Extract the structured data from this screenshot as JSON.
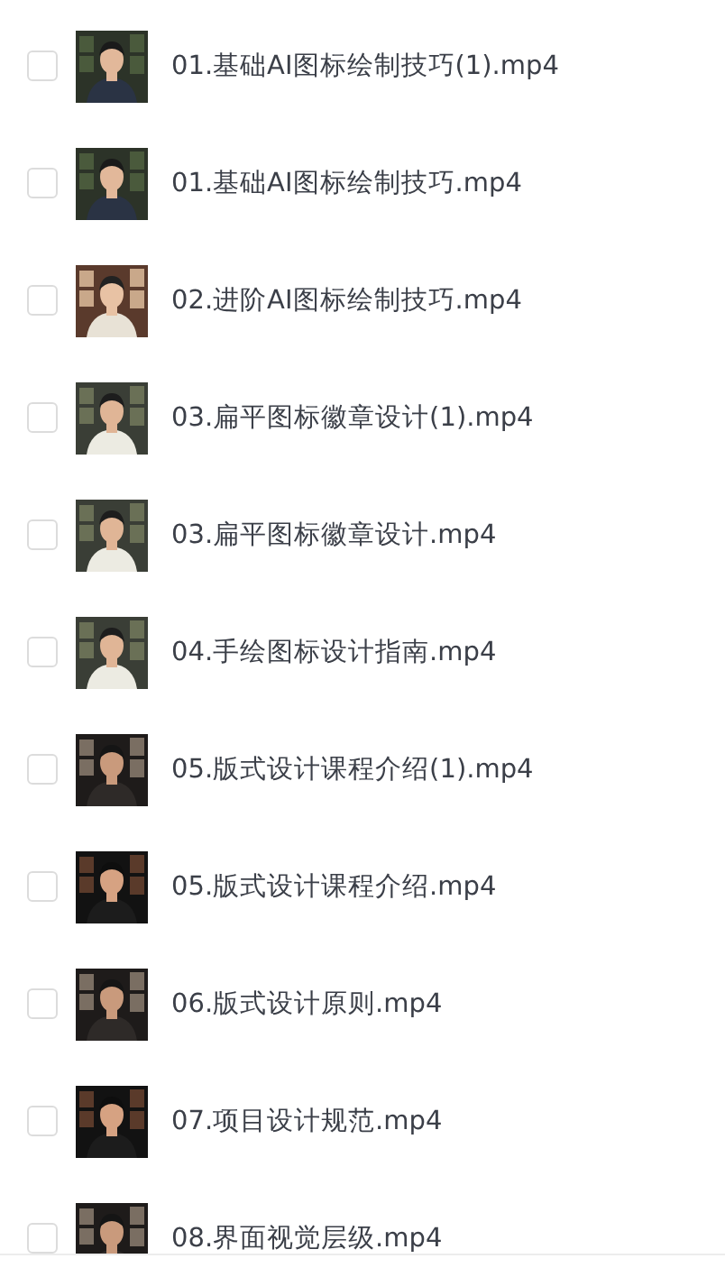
{
  "files": [
    {
      "name": "01.基础AI图标绘制技巧(1).mp4",
      "checked": false
    },
    {
      "name": "01.基础AI图标绘制技巧.mp4",
      "checked": false
    },
    {
      "name": "02.进阶AI图标绘制技巧.mp4",
      "checked": false
    },
    {
      "name": "03.扁平图标徽章设计(1).mp4",
      "checked": false
    },
    {
      "name": "03.扁平图标徽章设计.mp4",
      "checked": false
    },
    {
      "name": "04.手绘图标设计指南.mp4",
      "checked": false
    },
    {
      "name": "05.版式设计课程介绍(1).mp4",
      "checked": false
    },
    {
      "name": "05.版式设计课程介绍.mp4",
      "checked": false
    },
    {
      "name": "06.版式设计原则.mp4",
      "checked": false
    },
    {
      "name": "07.项目设计规范.mp4",
      "checked": false
    },
    {
      "name": "08.界面视觉层级.mp4",
      "checked": false
    }
  ]
}
